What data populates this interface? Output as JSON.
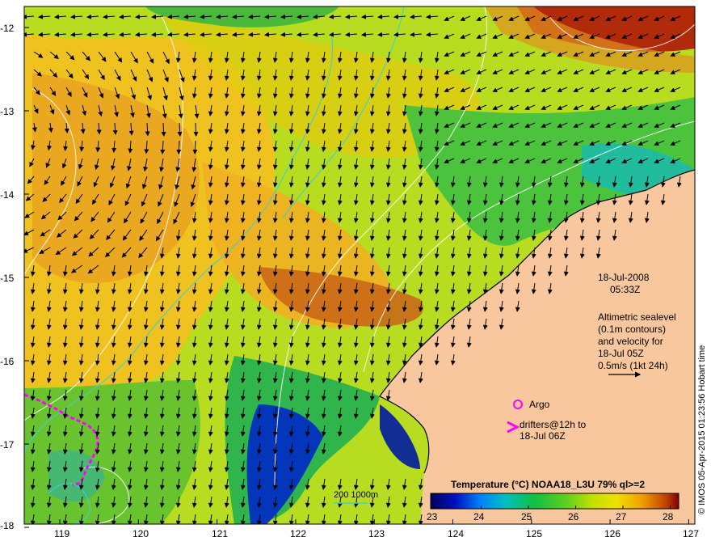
{
  "map": {
    "lon_ticks": [
      "119",
      "120",
      "121",
      "122",
      "123",
      "124",
      "125",
      "126",
      "127"
    ],
    "lat_ticks": [
      "-12",
      "-13",
      "-14",
      "-15",
      "-16",
      "-17",
      "-18"
    ],
    "date": "18-Jul-2008",
    "time": "05:33Z",
    "altimetry_lines": [
      "Altimetric sealevel",
      "(0.1m contours)",
      "and velocity for",
      "18-Jul 05Z",
      "0.5m/s (1kt 24h)"
    ],
    "argo_label": "Argo",
    "drifter_lines": [
      "drifters@12h to",
      "18-Jul 06Z"
    ],
    "isobath_label": "200  1000m",
    "colorbar_title": "Temperature (°C) NOAA18_L3U 79% ql>=2",
    "colorbar_ticks": [
      "23",
      "24",
      "25",
      "26",
      "27",
      "28"
    ],
    "credit": "© IMOS 05-Apr-2015 01:23:56 Hobart time",
    "colors": {
      "land": "#f9c79d",
      "isobath": "#40d0d0",
      "drifter": "#ff00ff",
      "arrow": "#000000",
      "contour": "#ffffff"
    }
  }
}
